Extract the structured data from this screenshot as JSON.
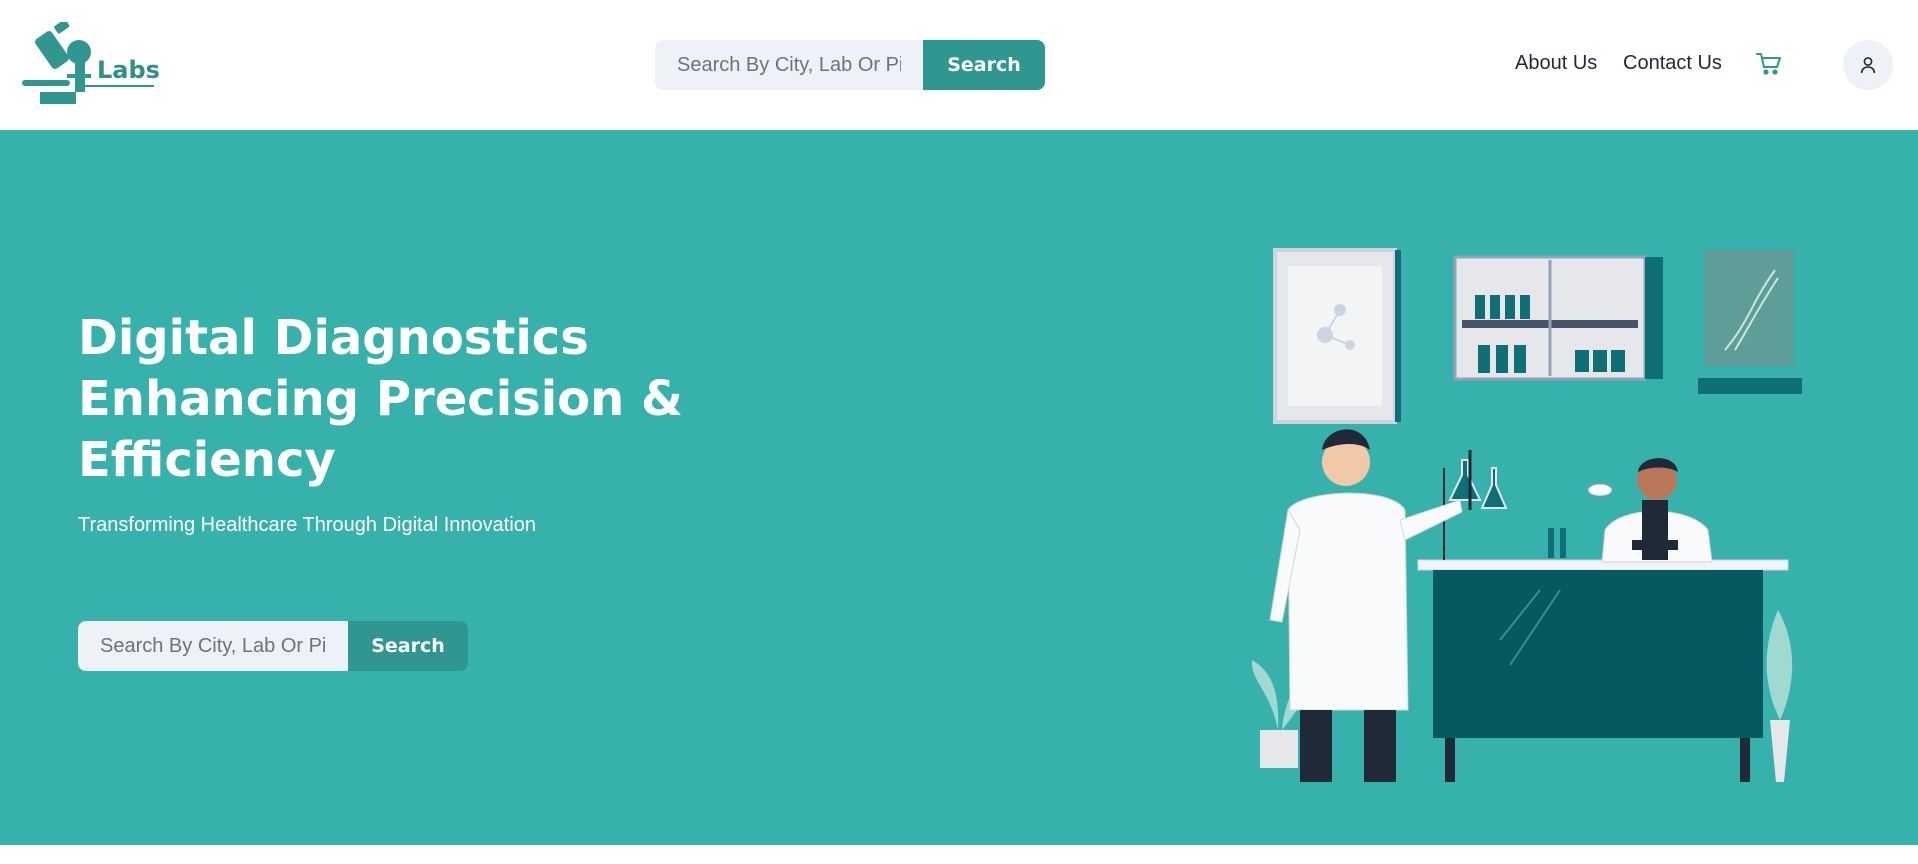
{
  "header": {
    "logo_text": "Labs",
    "search": {
      "placeholder": "Search By City, Lab Or Pin",
      "value": "",
      "button_label": "Search"
    },
    "nav": {
      "about": "About Us",
      "contact": "Contact Us"
    },
    "cart_icon": "cart-icon",
    "user_icon": "user-icon"
  },
  "hero": {
    "headline_lines": [
      "Digital Diagnostics",
      "Enhancing Precision &",
      "Efficiency"
    ],
    "subline": "Transforming Healthcare Through Digital Innovation",
    "search": {
      "placeholder": "Search By City, Lab Or Pin",
      "value": "",
      "button_label": "Search"
    },
    "illustration": "lab-scientists-illustration"
  },
  "colors": {
    "brand_teal": "#2f9690",
    "hero_background": "#37b1ac",
    "input_background": "#eef2f6",
    "text_dark": "#1f2937"
  }
}
